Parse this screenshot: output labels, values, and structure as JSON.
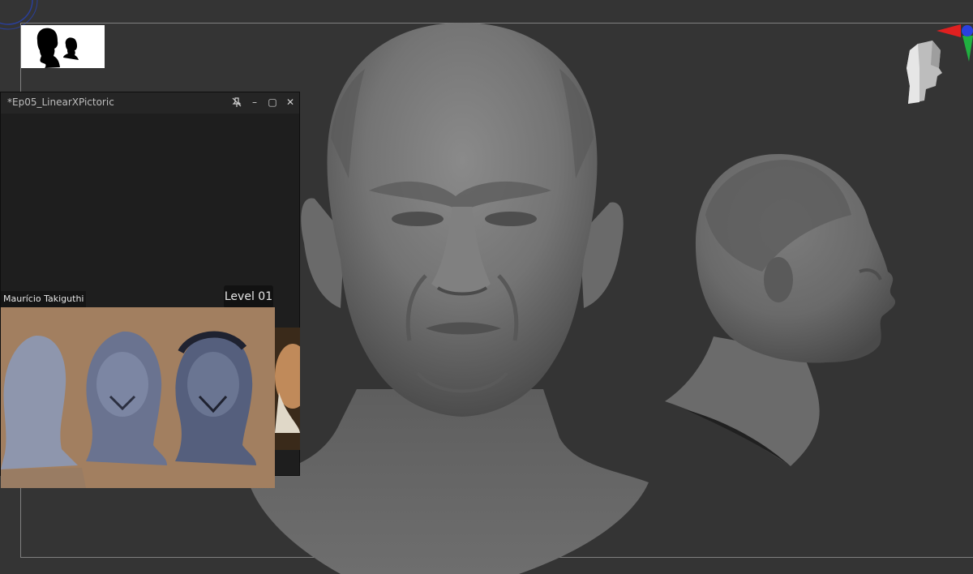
{
  "reference_window": {
    "title": "*Ep05_LinearXPictoric",
    "pin_icon": "unpin-icon",
    "minimize_icon": "minimize-icon",
    "maximize_icon": "maximize-icon",
    "close_icon": "close-icon",
    "minimize_glyph": "–",
    "maximize_glyph": "▢",
    "close_glyph": "✕",
    "author_label": "Maurício Takiguthi",
    "level_label": "Level 01",
    "painting_background": "#a27f60"
  },
  "viewport": {
    "background": "#343434",
    "frame_color": "#808080",
    "model_color": "#7c7c7c",
    "logo_icon": "two-heads-silhouette-icon",
    "navigation_icon": "head-navigation-cube-icon",
    "axis_icon": "axis-gizmo-icon"
  }
}
